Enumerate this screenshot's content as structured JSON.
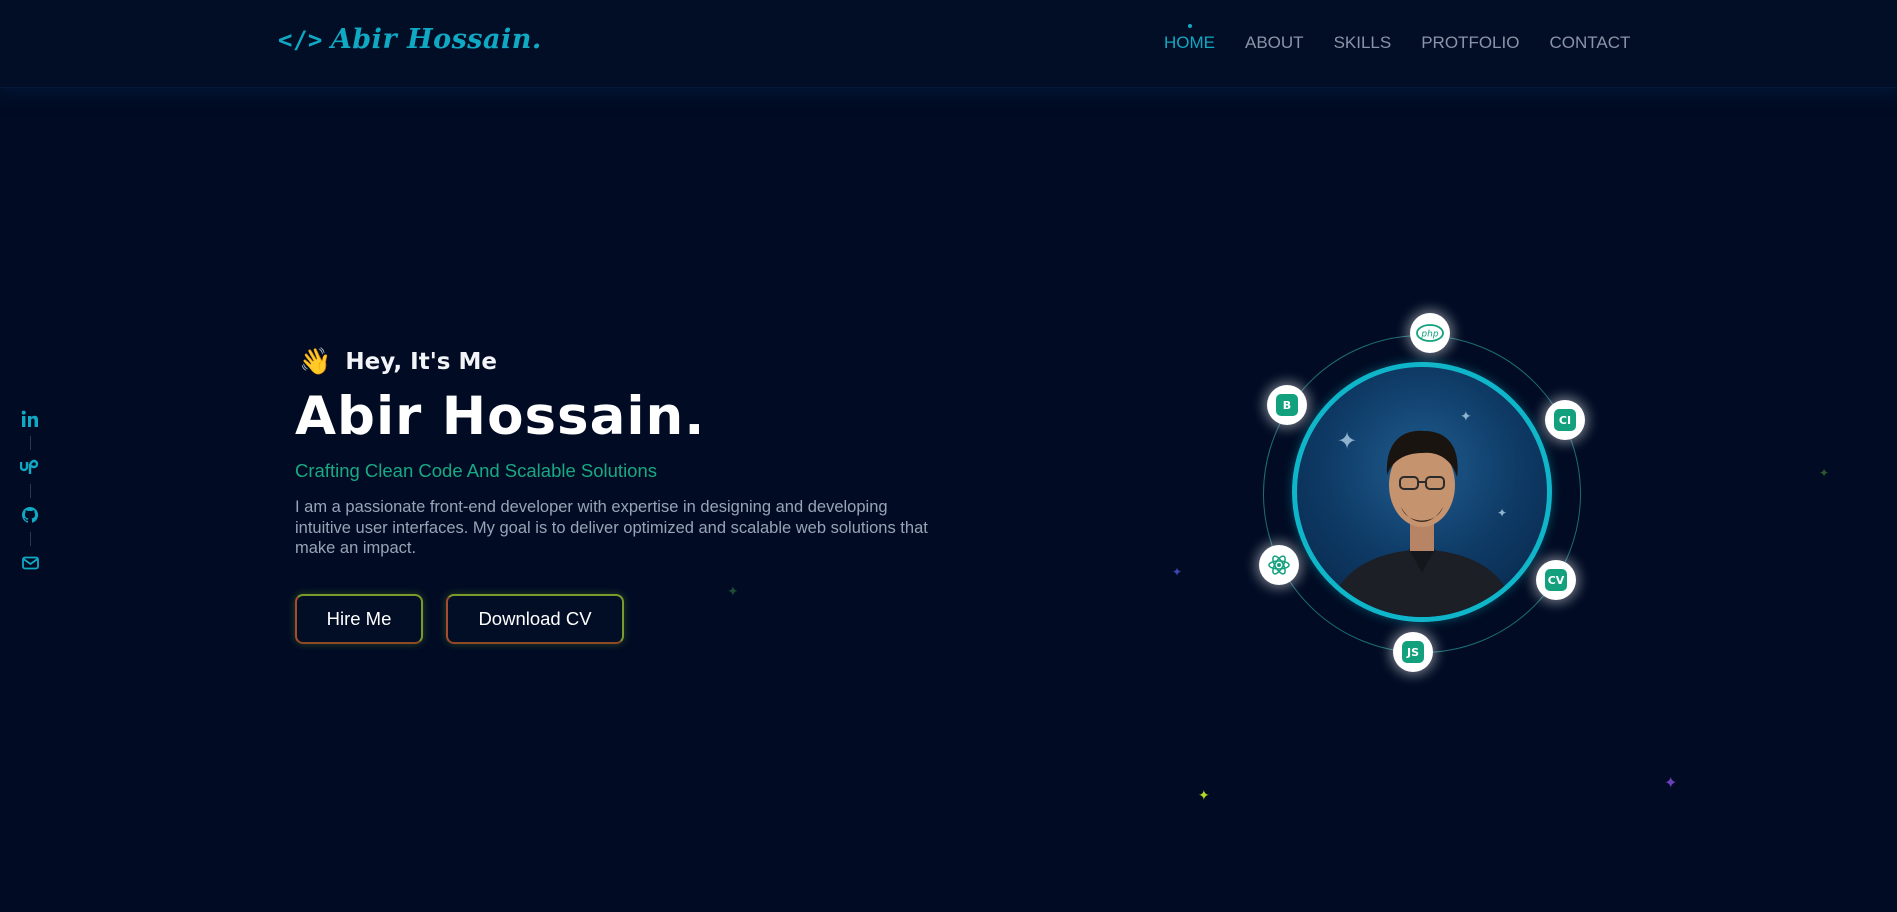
{
  "header": {
    "logo_code": "</>",
    "logo_text": "Abir Hossain.",
    "nav": [
      "HOME",
      "ABOUT",
      "SKILLS",
      "PROTFOLIO",
      "CONTACT"
    ],
    "active_nav": "HOME"
  },
  "social": [
    "linkedin-icon",
    "upwork-icon",
    "github-icon",
    "email-icon"
  ],
  "hero": {
    "wave": "👋",
    "greeting": "Hey, It's Me",
    "name": "Abir Hossain.",
    "tagline": "Crafting Clean Code And Scalable Solutions",
    "bio": "I am a passionate front-end developer with expertise in designing and developing intuitive user interfaces. My goal is to deliver optimized and scalable web solutions that make an impact.",
    "hire_label": "Hire Me",
    "cv_label": "Download CV"
  },
  "tech_badges": [
    "php",
    "B",
    "CI",
    "JS",
    "React",
    "CV"
  ],
  "colors": {
    "background": "#010c24",
    "accent": "#10a9c4",
    "tagline": "#18a884",
    "text_muted": "#8b93a7"
  }
}
